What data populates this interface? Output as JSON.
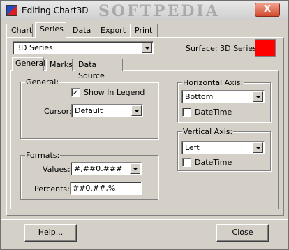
{
  "window": {
    "title": "Editing Chart3D",
    "watermark": "SOFTPEDIA",
    "close_symbol": "X"
  },
  "top_tabs": [
    {
      "label": "Chart"
    },
    {
      "label": "Series"
    },
    {
      "label": "Data"
    },
    {
      "label": "Export"
    },
    {
      "label": "Print"
    }
  ],
  "series_select": {
    "value": "3D Series"
  },
  "surface": {
    "label": "Surface: 3D Series",
    "color": "#ff0000"
  },
  "inner_tabs": [
    {
      "label": "General"
    },
    {
      "label": "Marks"
    },
    {
      "label": "Data Source"
    }
  ],
  "general_group": {
    "title": "General:",
    "show_in_legend": {
      "label": "Show In Legend",
      "checked": true
    },
    "cursor": {
      "label": "Cursor:",
      "value": "Default"
    }
  },
  "formats_group": {
    "title": "Formats:",
    "values": {
      "label": "Values:",
      "value": "#,##0.###"
    },
    "percents": {
      "label": "Percents:",
      "value": "##0.##,%"
    }
  },
  "horizontal_axis": {
    "title": "Horizontal Axis:",
    "value": "Bottom",
    "datetime_label": "DateTime"
  },
  "vertical_axis": {
    "title": "Vertical Axis:",
    "value": "Left",
    "datetime_label": "DateTime"
  },
  "footer": {
    "help_label": "Help...",
    "close_label": "Close"
  }
}
